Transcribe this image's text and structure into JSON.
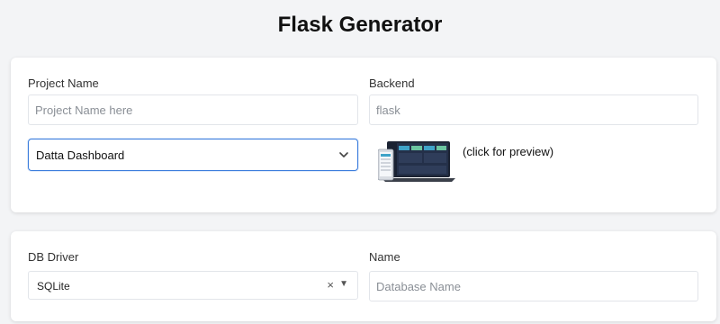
{
  "page": {
    "title": "Flask Generator"
  },
  "project": {
    "name_label": "Project Name",
    "name_placeholder": "Project Name here",
    "backend_label": "Backend",
    "backend_placeholder": "flask",
    "template_selected": "Datta Dashboard",
    "preview_text": "(click for preview)"
  },
  "database": {
    "driver_label": "DB Driver",
    "driver_selected": "SQLite",
    "clear_glyph": "×",
    "caret_glyph": "▼",
    "name_label": "Name",
    "name_placeholder": "Database Name"
  },
  "icons": {
    "chevron": "chevron-down-icon",
    "preview": "dashboard-preview-image"
  },
  "colors": {
    "accent": "#3b7ddd",
    "background": "#f3f4f6"
  }
}
